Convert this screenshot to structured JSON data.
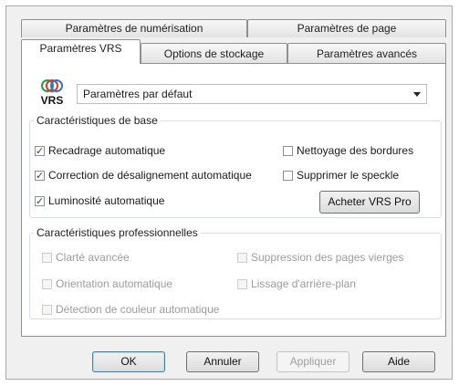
{
  "tabs_back": [
    {
      "label": "Paramètres de numérisation"
    },
    {
      "label": "Paramètres de page"
    }
  ],
  "tabs_front": [
    {
      "label": "Paramètres VRS",
      "active": true
    },
    {
      "label": "Options de stockage"
    },
    {
      "label": "Paramètres avancés"
    }
  ],
  "logo": {
    "text": "VRS"
  },
  "preset": {
    "value": "Paramètres par défaut"
  },
  "basic": {
    "legend": "Caractéristiques de base",
    "auto_crop": {
      "label": "Recadrage automatique",
      "checked": true
    },
    "auto_deskew": {
      "label": "Correction de désalignement automatique",
      "checked": true
    },
    "auto_brightness": {
      "label": "Luminosité automatique",
      "checked": true
    },
    "edge_clean": {
      "label": "Nettoyage des bordures",
      "checked": false
    },
    "despeckle": {
      "label": "Supprimer le speckle",
      "checked": false
    },
    "buy_label": "Acheter VRS Pro"
  },
  "pro": {
    "legend": "Caractéristiques professionnelles",
    "adv_clarity": {
      "label": "Clarté avancée"
    },
    "auto_orient": {
      "label": "Orientation automatique"
    },
    "auto_color": {
      "label": "Détection de couleur automatique"
    },
    "blank_remove": {
      "label": "Suppression des pages vierges"
    },
    "bg_smooth": {
      "label": "Lissage d'arrière-plan"
    }
  },
  "buttons": {
    "ok": "OK",
    "cancel": "Annuler",
    "apply": "Appliquer",
    "help": "Aide"
  }
}
